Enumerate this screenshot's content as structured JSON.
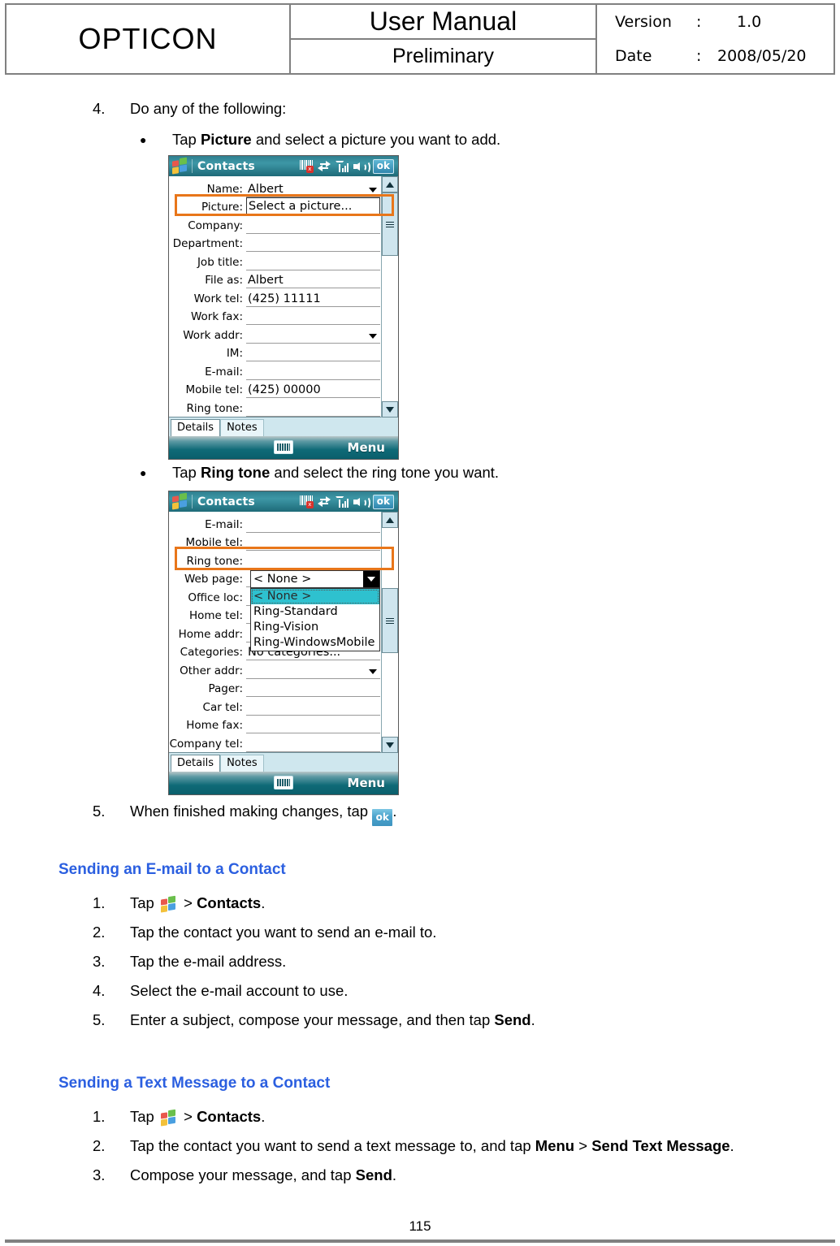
{
  "header": {
    "logo": "OPTICON",
    "title": "User Manual",
    "subtitle": "Preliminary",
    "version_label": "Version",
    "version_colon": ":",
    "version_value": "1.0",
    "date_label": "Date",
    "date_colon": ":",
    "date_value": "2008/05/20"
  },
  "body": {
    "step4_num": "4.",
    "step4_text": "Do any of the following:",
    "bullet_dot": "●",
    "bullet1_prefix": "Tap ",
    "bullet1_bold": "Picture",
    "bullet1_suffix": " and select a picture you want to add.",
    "bullet2_prefix": "Tap ",
    "bullet2_bold": "Ring tone",
    "bullet2_suffix": " and select the ring tone you want.",
    "step5_num": "5.",
    "step5_prefix": "When finished making changes, tap ",
    "step5_ok": "ok",
    "step5_suffix": "."
  },
  "section_email": {
    "heading": "Sending an E-mail to a Contact",
    "steps": [
      {
        "num": "1.",
        "prefix": "Tap ",
        "icon": "windows-start-icon",
        "mid": " > ",
        "bold": "Contacts",
        "suffix": "."
      },
      {
        "num": "2.",
        "prefix": "Tap the contact you want to send an e-mail to.",
        "bold": "",
        "suffix": ""
      },
      {
        "num": "3.",
        "prefix": "Tap the e-mail address.",
        "bold": "",
        "suffix": ""
      },
      {
        "num": "4.",
        "prefix": "Select the e-mail account to use.",
        "bold": "",
        "suffix": ""
      },
      {
        "num": "5.",
        "prefix": "Enter a subject, compose your message, and then tap ",
        "bold": "Send",
        "suffix": "."
      }
    ]
  },
  "section_sms": {
    "heading": "Sending a Text Message to a Contact",
    "steps": [
      {
        "num": "1.",
        "prefix": "Tap ",
        "icon": "windows-start-icon",
        "mid": " > ",
        "bold": "Contacts",
        "suffix": "."
      },
      {
        "num": "2.",
        "prefix": "Tap the contact you want to send a text message to, and tap ",
        "bold": "Menu",
        "mid2": " > ",
        "bold2": "Send Text Message",
        "suffix": "."
      },
      {
        "num": "3.",
        "prefix": "Compose your message, and tap ",
        "bold": "Send",
        "suffix": "."
      }
    ]
  },
  "page_number": "115",
  "colors": {
    "heading_blue": "#2b5fe0",
    "highlight_orange": "#e8761a",
    "titlebar_teal": "#2f7f8f",
    "dropdown_selection": "#2ec1cf",
    "rule_gray": "#808080"
  },
  "screenshot1": {
    "name": "contacts-picture-screen",
    "titlebar": {
      "title": "Contacts",
      "ok_label": "ok",
      "tray_icons": [
        "barcode-scanner-icon",
        "connectivity-icon",
        "signal-strength-icon",
        "speaker-icon"
      ]
    },
    "fields": [
      {
        "label": "Name:",
        "value": "Albert",
        "caret": true,
        "boxed": false
      },
      {
        "label": "Picture:",
        "value": "Select a picture...",
        "caret": false,
        "boxed": true
      },
      {
        "label": "Company:",
        "value": "",
        "caret": false,
        "boxed": false
      },
      {
        "label": "Department:",
        "value": "",
        "caret": false,
        "boxed": false
      },
      {
        "label": "Job title:",
        "value": "",
        "caret": false,
        "boxed": false
      },
      {
        "label": "File as:",
        "value": "Albert",
        "caret": false,
        "boxed": false
      },
      {
        "label": "Work tel:",
        "value": "(425) 11111",
        "caret": false,
        "boxed": false
      },
      {
        "label": "Work fax:",
        "value": "",
        "caret": false,
        "boxed": false
      },
      {
        "label": "Work addr:",
        "value": "",
        "caret": true,
        "boxed": false
      },
      {
        "label": "IM:",
        "value": "",
        "caret": false,
        "boxed": false
      },
      {
        "label": "E-mail:",
        "value": "",
        "caret": false,
        "boxed": false
      },
      {
        "label": "Mobile tel:",
        "value": "(425) 00000",
        "caret": false,
        "boxed": false
      },
      {
        "label": "Ring tone:",
        "value": "",
        "caret": false,
        "boxed": false
      }
    ],
    "tabs": [
      {
        "label": "Details",
        "active": true
      },
      {
        "label": "Notes",
        "active": false
      }
    ],
    "menubar": {
      "menu_label": "Menu",
      "keyboard_icon": "soft-keyboard-icon"
    }
  },
  "screenshot2": {
    "name": "contacts-ringtone-screen",
    "titlebar": {
      "title": "Contacts",
      "ok_label": "ok",
      "tray_icons": [
        "barcode-scanner-icon",
        "connectivity-icon",
        "signal-strength-icon",
        "speaker-icon"
      ]
    },
    "fields": [
      {
        "label": "E-mail:",
        "value": "",
        "caret": false
      },
      {
        "label": "Mobile tel:",
        "value": "",
        "caret": false
      },
      {
        "label": "Ring tone:",
        "value": "",
        "caret": false
      },
      {
        "label": "Web page:",
        "value": "",
        "caret": false
      },
      {
        "label": "Office loc:",
        "value": "",
        "caret": false
      },
      {
        "label": "Home tel:",
        "value": "",
        "caret": false
      },
      {
        "label": "Home addr:",
        "value": "",
        "caret": false
      },
      {
        "label": "Categories:",
        "value": "No categories...",
        "caret": false
      },
      {
        "label": "Other addr:",
        "value": "",
        "caret": true
      },
      {
        "label": "Pager:",
        "value": "",
        "caret": false
      },
      {
        "label": "Car tel:",
        "value": "",
        "caret": false
      },
      {
        "label": "Home fax:",
        "value": "",
        "caret": false
      },
      {
        "label": "Company tel:",
        "value": "",
        "caret": false
      }
    ],
    "dropdown": {
      "selected": "< None >",
      "options": [
        "< None >",
        "Ring-Standard",
        "Ring-Vision",
        "Ring-WindowsMobile"
      ]
    },
    "tabs": [
      {
        "label": "Details",
        "active": true
      },
      {
        "label": "Notes",
        "active": false
      }
    ],
    "menubar": {
      "menu_label": "Menu",
      "keyboard_icon": "soft-keyboard-icon"
    }
  }
}
